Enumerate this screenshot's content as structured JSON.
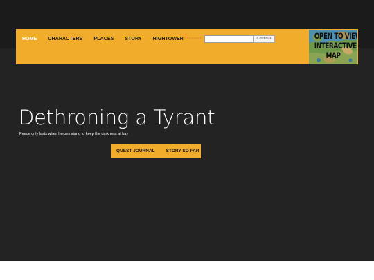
{
  "nav": {
    "items": [
      {
        "label": "HOME",
        "active": true
      },
      {
        "label": "CHARACTERS",
        "active": false
      },
      {
        "label": "PLACES",
        "active": false
      },
      {
        "label": "STORY",
        "active": false
      },
      {
        "label": "HIGHTOWER",
        "active": false
      }
    ],
    "password_label": "Password:",
    "password_value": "",
    "continue_label": "Continue"
  },
  "map_link": {
    "lines": [
      "OPEN TO VIEW",
      "INTERACTIVE",
      "MAP"
    ]
  },
  "hero": {
    "title": "Dethroning a Tyrant",
    "subtitle": "Peace only lasts when heroes stand to keep the darkness at bay"
  },
  "actions": {
    "quest_journal": "QUEST JOURNAL",
    "story_so_far": "STORY SO FAR"
  },
  "colors": {
    "accent": "#f2ac2c",
    "background": "#232323",
    "header_strip": "#1b1b1b",
    "active_nav": "#ffffff"
  }
}
